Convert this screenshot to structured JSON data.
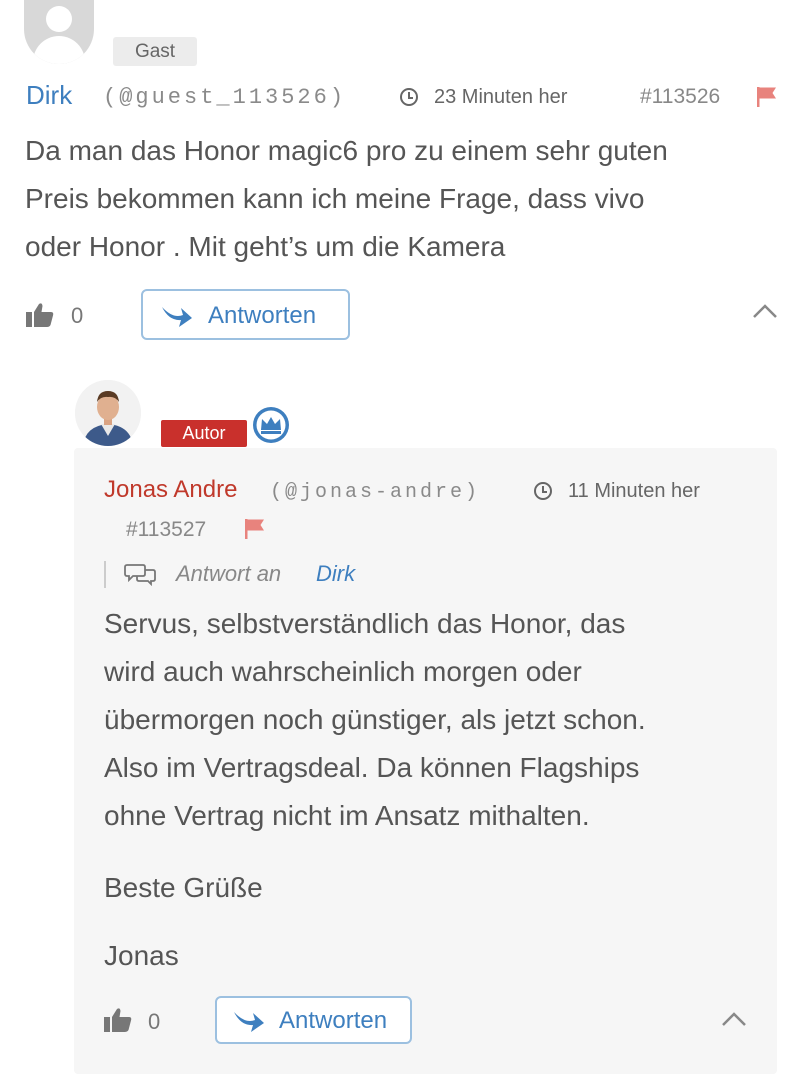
{
  "comment": {
    "badge": "Gast",
    "author": "Dirk",
    "handle": "(@guest_113526)",
    "time": "23 Minuten her",
    "id": "#113526",
    "body_lines": [
      "Da man das Honor magic6 pro zu einem sehr guten",
      "Preis bekommen kann ich meine Frage, dass vivo",
      "oder Honor . Mit geht’s um die Kamera"
    ],
    "likes": "0",
    "reply_label": "Antworten"
  },
  "reply": {
    "badge": "Autor",
    "author": "Jonas Andre",
    "handle": "(@jonas-andre)",
    "time": "11 Minuten her",
    "id": "#113527",
    "reply_to_prefix": "Antwort an",
    "reply_to_name": "Dirk",
    "body_lines": [
      "Servus, selbstverständlich das Honor, das",
      "wird auch wahrscheinlich morgen oder",
      "übermorgen noch günstiger, als jetzt schon.",
      "Also im Vertragsdeal. Da können Flagships",
      "ohne Vertrag nicht im Ansatz mithalten."
    ],
    "greeting": "Beste Grüße",
    "signature": "Jonas",
    "likes": "0",
    "reply_label": "Antworten"
  },
  "colors": {
    "link_blue": "#3e7fbf",
    "author_red": "#c0392b",
    "badge_red": "#c9302c",
    "flag": "#e8837d"
  },
  "icons": [
    "user-avatar-icon",
    "clock-icon",
    "flag-icon",
    "thumbs-up-icon",
    "reply-arrow-icon",
    "chevron-up-icon",
    "crown-icon",
    "speech-bubbles-icon"
  ]
}
